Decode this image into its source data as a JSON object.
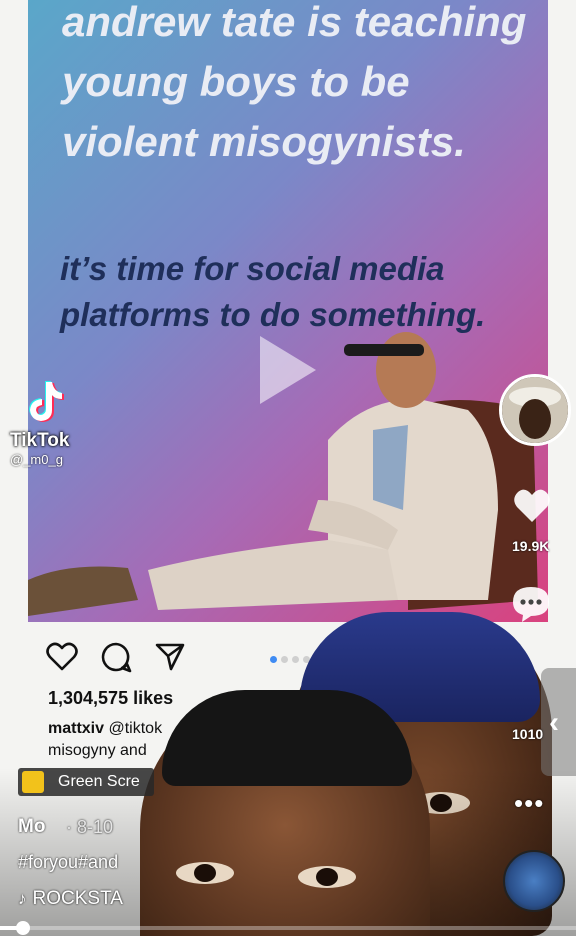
{
  "post": {
    "headline": "andrew tate is teaching young boys to be violent misogynists.",
    "subline": "it’s time for social media platforms to do something."
  },
  "tiktok": {
    "brand": "TikTok",
    "handle": "@_m0_g"
  },
  "right_rail": {
    "likes": "19.9K",
    "comments": "1010"
  },
  "instagram": {
    "likes": "1,304,575 likes",
    "caption_user": "mattxiv",
    "caption_text_start": "@tiktok",
    "caption_line2": "misogyny and",
    "active_slide": 1,
    "slide_count": 4
  },
  "video_info": {
    "effect_label": "Green Scre",
    "username": "Mo",
    "date": "· 8-10",
    "hashtags": "#foryou#and",
    "sound": "ROCKSTA",
    "progress_percent": 4
  },
  "colors": {
    "accent_blue": "#3f8bf3",
    "effect_yellow": "#f2c21b"
  },
  "icons": [
    "tiktok-logo-icon",
    "heart-icon",
    "comment-icon",
    "share-icon",
    "bookmark-icon",
    "play-icon",
    "music-note-icon",
    "chevron-left-icon",
    "more-icon"
  ]
}
